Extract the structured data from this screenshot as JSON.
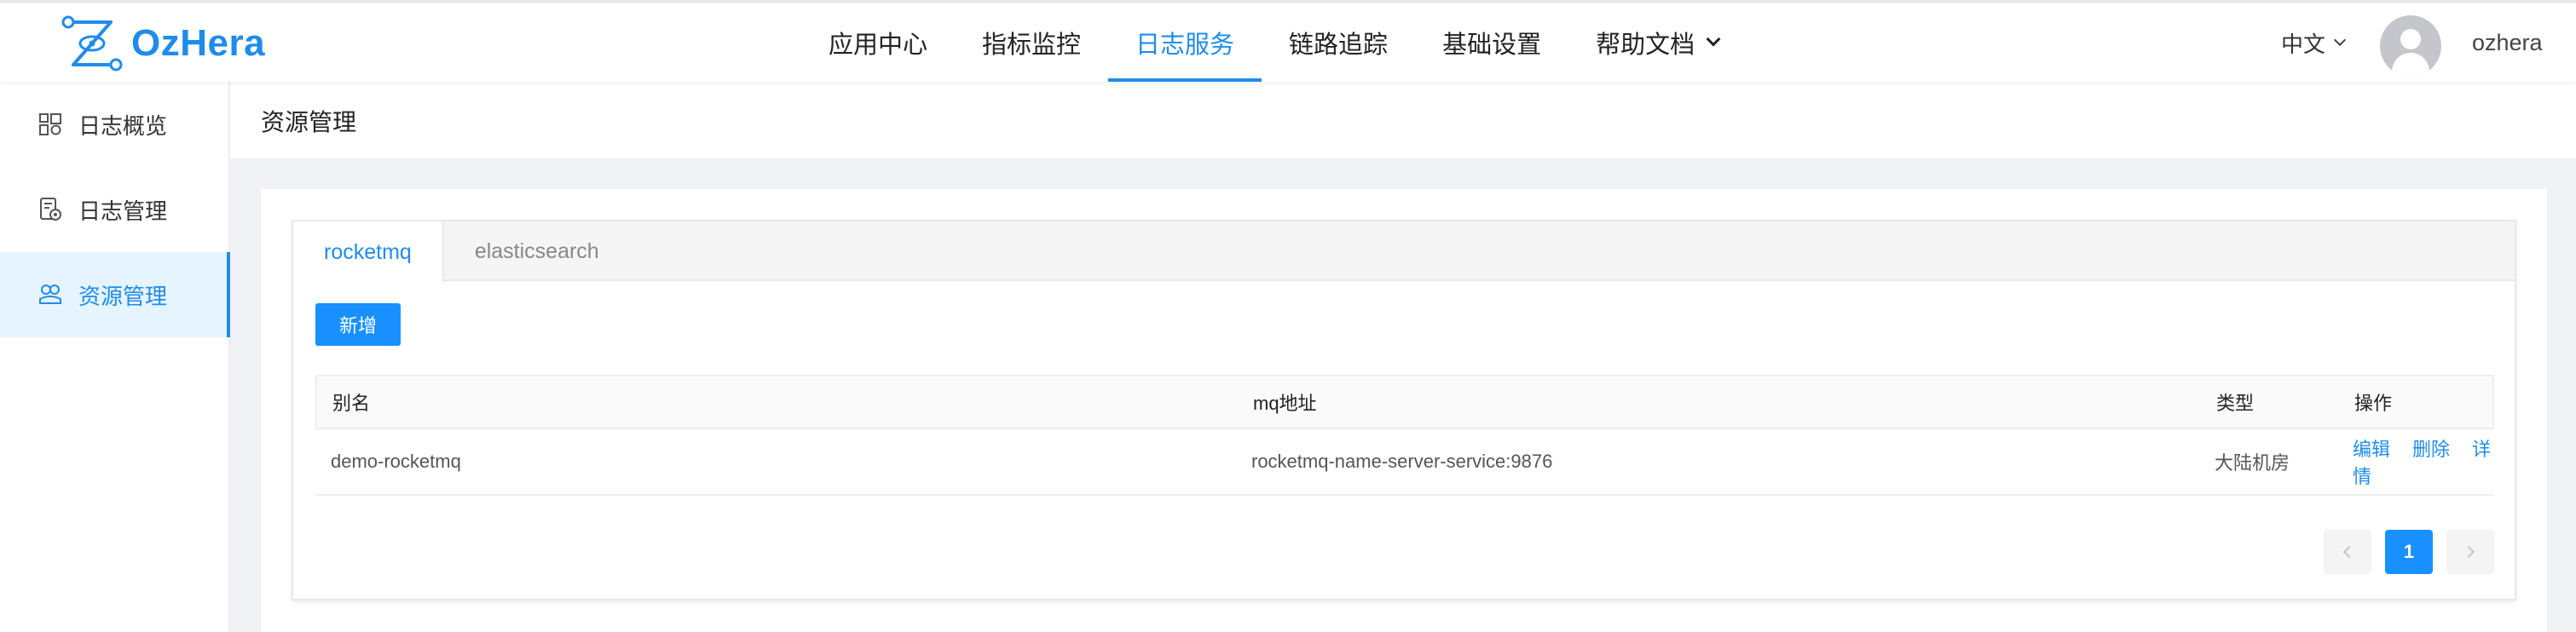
{
  "brand": {
    "name": "OzHera",
    "color": "#1f8ceb"
  },
  "nav": {
    "items": [
      {
        "label": "应用中心"
      },
      {
        "label": "指标监控"
      },
      {
        "label": "日志服务"
      },
      {
        "label": "链路追踪"
      },
      {
        "label": "基础设置"
      },
      {
        "label": "帮助文档"
      }
    ],
    "active": "日志服务",
    "language": "中文",
    "username": "ozhera"
  },
  "sidebar": {
    "items": [
      {
        "label": "日志概览",
        "icon": "overview-icon"
      },
      {
        "label": "日志管理",
        "icon": "log-manage-icon"
      },
      {
        "label": "资源管理",
        "icon": "resource-icon"
      }
    ],
    "active": "资源管理"
  },
  "page": {
    "title": "资源管理"
  },
  "tabs": [
    {
      "label": "rocketmq"
    },
    {
      "label": "elasticsearch"
    }
  ],
  "active_tab": "rocketmq",
  "actions": {
    "add_label": "新增"
  },
  "table": {
    "columns": [
      "别名",
      "mq地址",
      "类型",
      "操作"
    ],
    "rows": [
      {
        "alias": "demo-rocketmq",
        "address": "rocketmq-name-server-service:9876",
        "type": "大陆机房",
        "ops": [
          "编辑",
          "删除",
          "详情"
        ]
      }
    ]
  },
  "pagination": {
    "current": "1"
  }
}
